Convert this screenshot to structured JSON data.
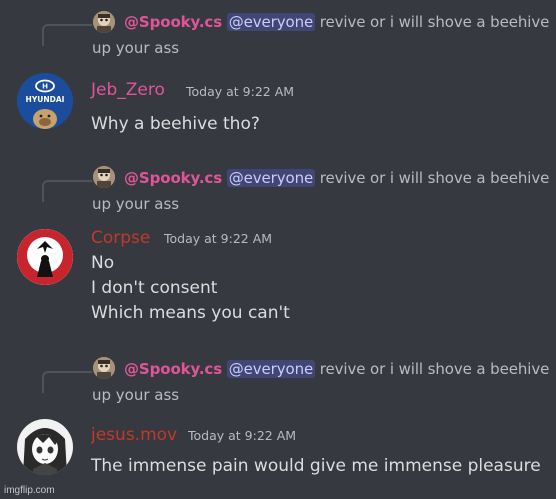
{
  "replied_message": {
    "author": "@Spooky.cs",
    "mention": "@everyone",
    "text_line1": " revive or i will shove a beehive",
    "text_line2": "up your ass",
    "avatar_icon": "spooky-avatar-icon"
  },
  "messages": [
    {
      "author": "Jeb_Zero",
      "author_color": "#e0559a",
      "timestamp": "Today at 9:22 AM",
      "lines": [
        "Why a beehive tho?"
      ],
      "avatar_icon": "hyundai-dog-avatar-icon",
      "avatar_text": "HYUNDAI"
    },
    {
      "author": "Corpse",
      "author_color": "#c0392b",
      "timestamp": "Today at 9:22 AM",
      "lines": [
        "No",
        "I don't consent",
        "Which means you can't"
      ],
      "avatar_icon": "corpse-raven-avatar-icon"
    },
    {
      "author": "jesus.mov",
      "author_color": "#c0392b",
      "timestamp": "Today at 9:22 AM",
      "lines": [
        "The immense pain would give me immense pleasure"
      ],
      "avatar_icon": "anime-girl-avatar-icon"
    }
  ],
  "watermark": "imgflip.com",
  "colors": {
    "background": "#36393f",
    "mention_bg": "#414675",
    "reply_author": "#e0559a"
  }
}
